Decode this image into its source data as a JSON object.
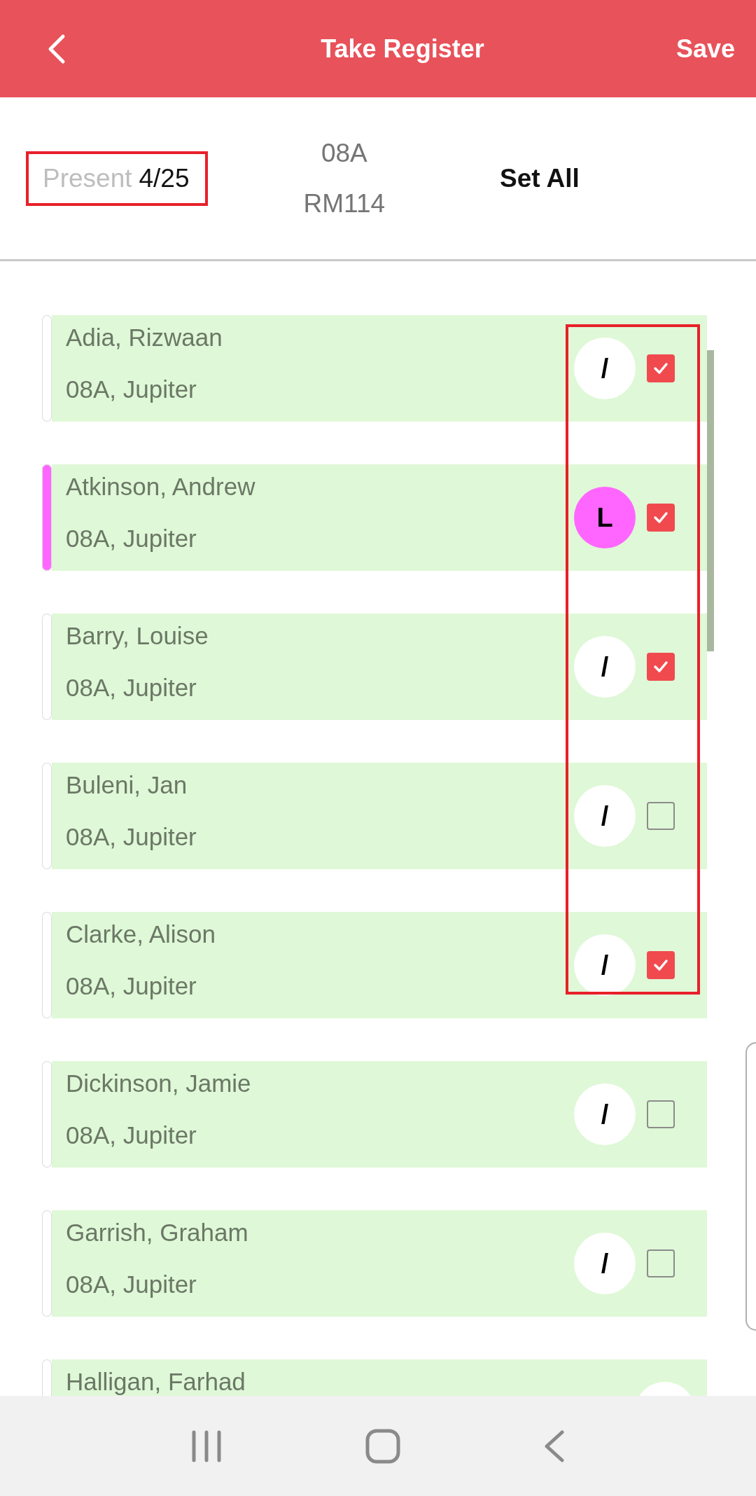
{
  "header": {
    "title": "Take Register",
    "action": "Save"
  },
  "summary": {
    "present_label": "Present",
    "present_count": "4/25",
    "group": "08A",
    "room": "RM114",
    "set_all": "Set All"
  },
  "students": [
    {
      "name": "Adia, Rizwaan",
      "class": "08A, Jupiter",
      "mark": "/",
      "color": "#ffffff",
      "checked": true
    },
    {
      "name": "Atkinson, Andrew",
      "class": "08A, Jupiter",
      "mark": "L",
      "color": "#ff66ff",
      "checked": true
    },
    {
      "name": "Barry, Louise",
      "class": "08A, Jupiter",
      "mark": "/",
      "color": "#ffffff",
      "checked": true
    },
    {
      "name": "Buleni, Jan",
      "class": "08A, Jupiter",
      "mark": "/",
      "color": "#ffffff",
      "checked": false
    },
    {
      "name": "Clarke, Alison",
      "class": "08A, Jupiter",
      "mark": "/",
      "color": "#ffffff",
      "checked": true
    },
    {
      "name": "Dickinson, Jamie",
      "class": "08A, Jupiter",
      "mark": "/",
      "color": "#ffffff",
      "checked": false
    },
    {
      "name": "Garrish, Graham",
      "class": "08A, Jupiter",
      "mark": "/",
      "color": "#ffffff",
      "checked": false
    },
    {
      "name": "Halligan, Farhad",
      "color": "#ffffff"
    }
  ]
}
